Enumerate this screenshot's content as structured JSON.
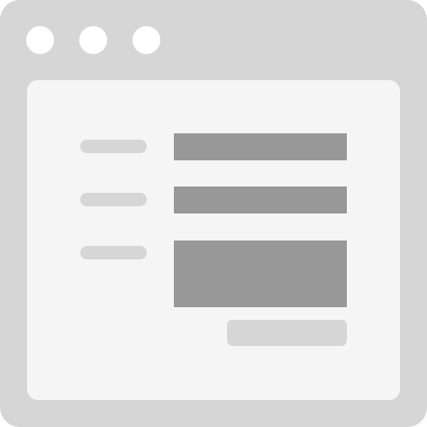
{
  "colors": {
    "window_frame": "#d6d6d6",
    "window_dots": "#ffffff",
    "content_background": "#f5f5f5",
    "label_placeholder": "#d6d6d6",
    "field_placeholder": "#989898",
    "button_placeholder": "#d6d6d6"
  },
  "icons": {
    "window_controls": [
      "window-dot-icon",
      "window-dot-icon",
      "window-dot-icon"
    ]
  },
  "form": {
    "fields": [
      {
        "kind": "single-line"
      },
      {
        "kind": "single-line"
      },
      {
        "kind": "multi-line"
      }
    ],
    "submit": {
      "kind": "button"
    }
  }
}
